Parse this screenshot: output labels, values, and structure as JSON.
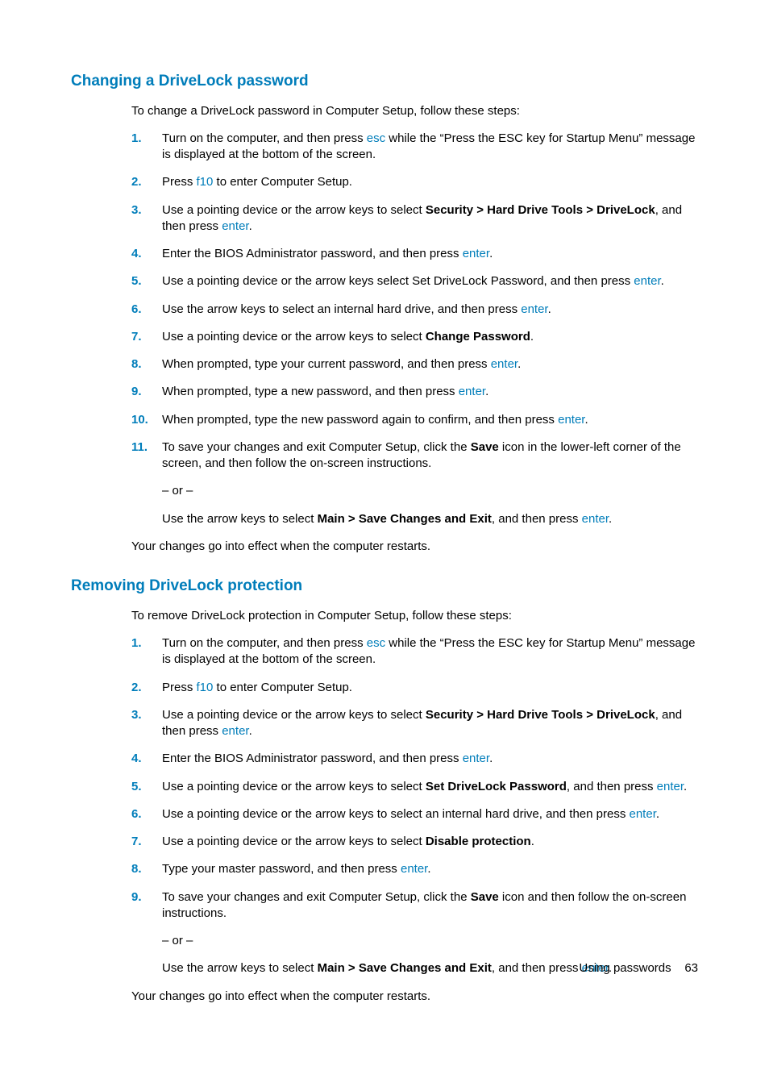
{
  "section1": {
    "heading": "Changing a DriveLock password",
    "intro": "To change a DriveLock password in Computer Setup, follow these steps:",
    "closing": "Your changes go into effect when the computer restarts.",
    "steps": {
      "n1": "1.",
      "s1a": "Turn on the computer, and then press ",
      "s1key": "esc",
      "s1b": " while the “Press the ESC key for Startup Menu” message is displayed at the bottom of the screen.",
      "n2": "2.",
      "s2a": "Press ",
      "s2key": "f10",
      "s2b": " to enter Computer Setup.",
      "n3": "3.",
      "s3a": "Use a pointing device or the arrow keys to select ",
      "s3bold": "Security > Hard Drive Tools > DriveLock",
      "s3b": ", and then press ",
      "s3key": "enter",
      "s3c": ".",
      "n4": "4.",
      "s4a": "Enter the BIOS Administrator password, and then press ",
      "s4key": "enter",
      "s4b": ".",
      "n5": "5.",
      "s5a": "Use a pointing device or the arrow keys select Set DriveLock Password, and then press ",
      "s5key": "enter",
      "s5b": ".",
      "n6": "6.",
      "s6a": "Use the arrow keys to select an internal hard drive, and then press ",
      "s6key": "enter",
      "s6b": ".",
      "n7": "7.",
      "s7a": "Use a pointing device or the arrow keys to select ",
      "s7bold": "Change Password",
      "s7b": ".",
      "n8": "8.",
      "s8a": "When prompted, type your current password, and then press ",
      "s8key": "enter",
      "s8b": ".",
      "n9": "9.",
      "s9a": "When prompted, type a new password, and then press ",
      "s9key": "enter",
      "s9b": ".",
      "n10": "10.",
      "s10a": "When prompted, type the new password again to confirm, and then press ",
      "s10key": "enter",
      "s10b": ".",
      "n11": "11.",
      "s11a": "To save your changes and exit Computer Setup, click the ",
      "s11bold1": "Save",
      "s11b": " icon in the lower-left corner of the screen, and then follow the on-screen instructions.",
      "s11or": "– or –",
      "s11c": "Use the arrow keys to select ",
      "s11bold2": "Main > Save Changes and Exit",
      "s11d": ", and then press ",
      "s11key": "enter",
      "s11e": "."
    }
  },
  "section2": {
    "heading": "Removing DriveLock protection",
    "intro": "To remove DriveLock protection in Computer Setup, follow these steps:",
    "closing": "Your changes go into effect when the computer restarts.",
    "steps": {
      "n1": "1.",
      "s1a": "Turn on the computer, and then press ",
      "s1key": "esc",
      "s1b": " while the “Press the ESC key for Startup Menu” message is displayed at the bottom of the screen.",
      "n2": "2.",
      "s2a": "Press ",
      "s2key": "f10",
      "s2b": " to enter Computer Setup.",
      "n3": "3.",
      "s3a": "Use a pointing device or the arrow keys to select ",
      "s3bold": "Security > Hard Drive Tools > DriveLock",
      "s3b": ", and then press ",
      "s3key": "enter",
      "s3c": ".",
      "n4": "4.",
      "s4a": "Enter the BIOS Administrator password, and then press ",
      "s4key": "enter",
      "s4b": ".",
      "n5": "5.",
      "s5a": "Use a pointing device or the arrow keys to select ",
      "s5bold": "Set DriveLock Password",
      "s5b": ", and then press ",
      "s5key": "enter",
      "s5c": ".",
      "n6": "6.",
      "s6a": "Use a pointing device or the arrow keys to select an internal hard drive, and then press ",
      "s6key": "enter",
      "s6b": ".",
      "n7": "7.",
      "s7a": "Use a pointing device or the arrow keys to select ",
      "s7bold": "Disable protection",
      "s7b": ".",
      "n8": "8.",
      "s8a": "Type your master password, and then press ",
      "s8key": "enter",
      "s8b": ".",
      "n9": "9.",
      "s9a": "To save your changes and exit Computer Setup, click the ",
      "s9bold1": "Save",
      "s9b": " icon and then follow the on-screen instructions.",
      "s9or": "– or –",
      "s9c": "Use the arrow keys to select ",
      "s9bold2": "Main > Save Changes and Exit",
      "s9d": ", and then press ",
      "s9key": "enter",
      "s9e": "."
    }
  },
  "footer": {
    "label": "Using passwords",
    "page": "63"
  }
}
